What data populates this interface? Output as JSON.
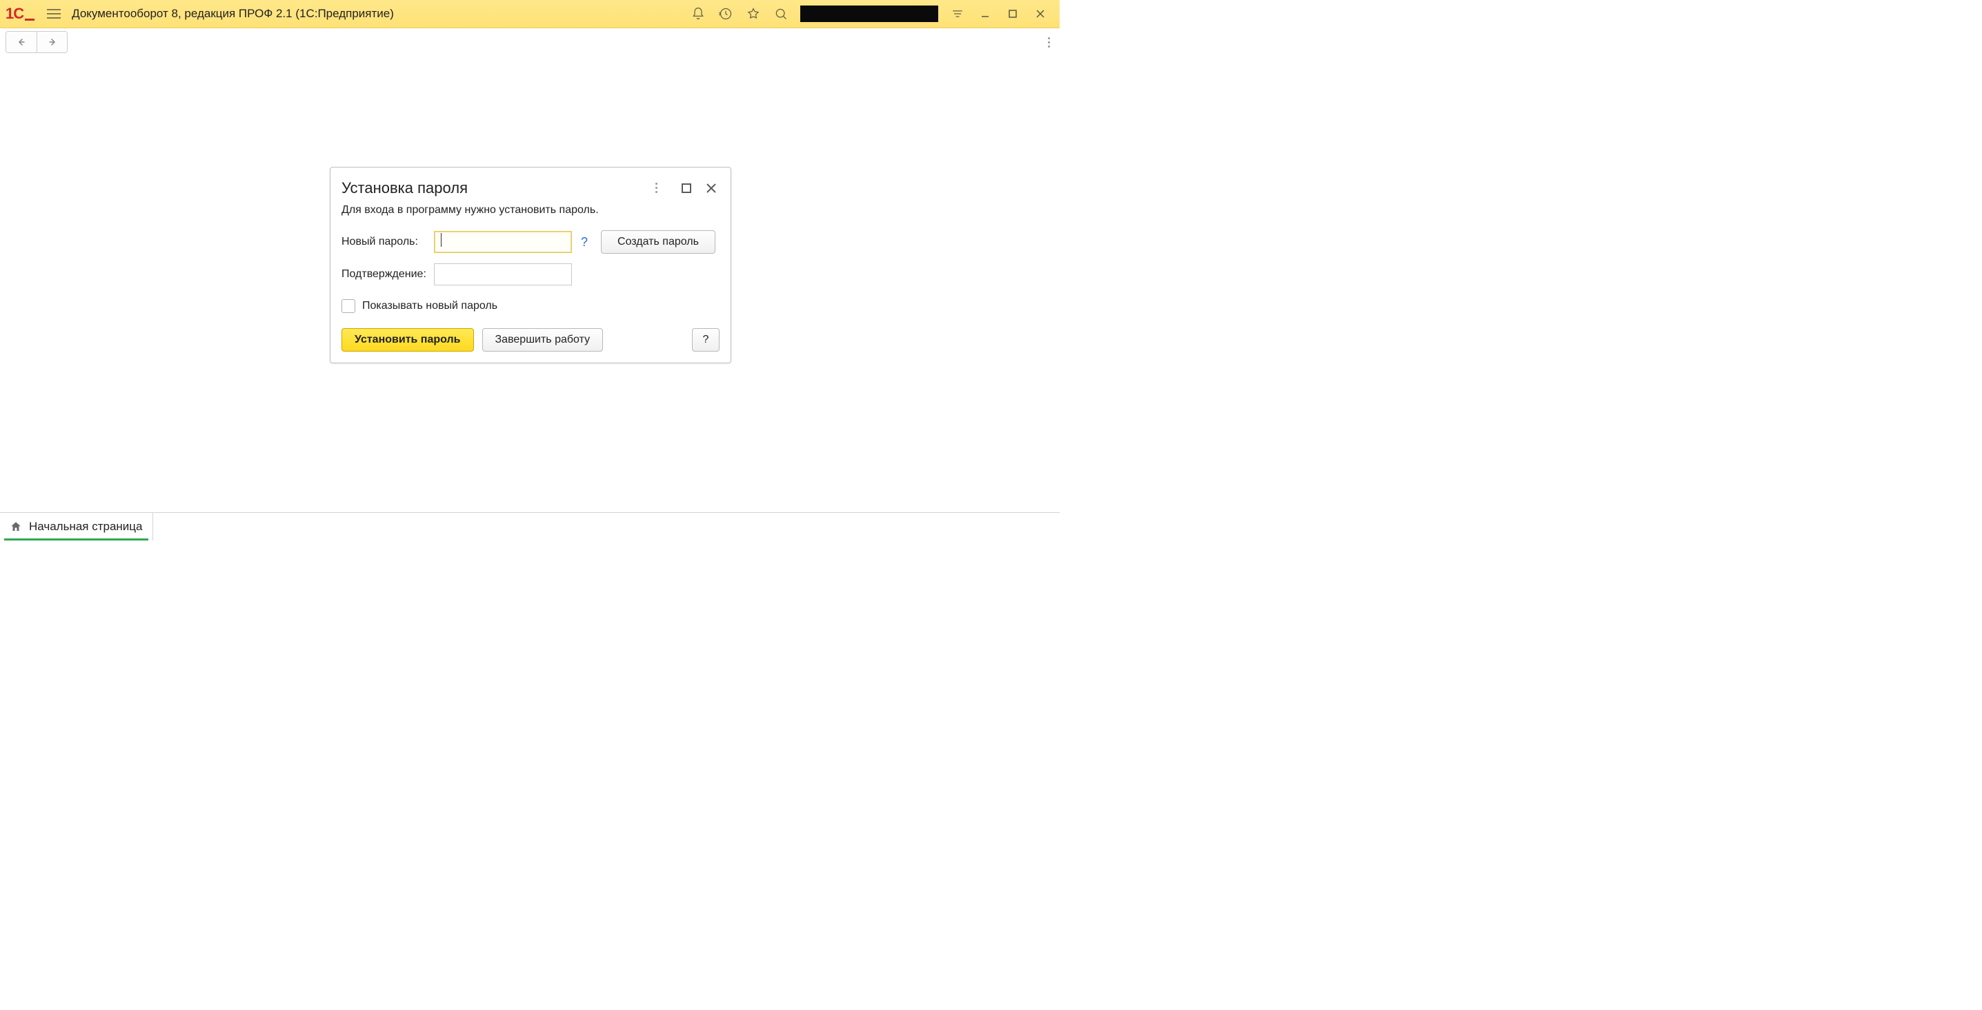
{
  "titlebar": {
    "app_title": "Документооборот 8, редакция ПРОФ 2.1  (1С:Предприятие)"
  },
  "dialog": {
    "title": "Установка пароля",
    "subtitle": "Для входа в программу нужно установить пароль.",
    "new_password_label": "Новый пароль:",
    "new_password_value": "",
    "confirm_label": "Подтверждение:",
    "confirm_value": "",
    "help_symbol": "?",
    "generate_btn": "Создать пароль",
    "show_password_label": "Показывать новый пароль",
    "show_password_checked": false,
    "set_password_btn": "Установить пароль",
    "finish_btn": "Завершить работу",
    "help_btn": "?"
  },
  "bottombar": {
    "tab_label": "Начальная страница"
  }
}
